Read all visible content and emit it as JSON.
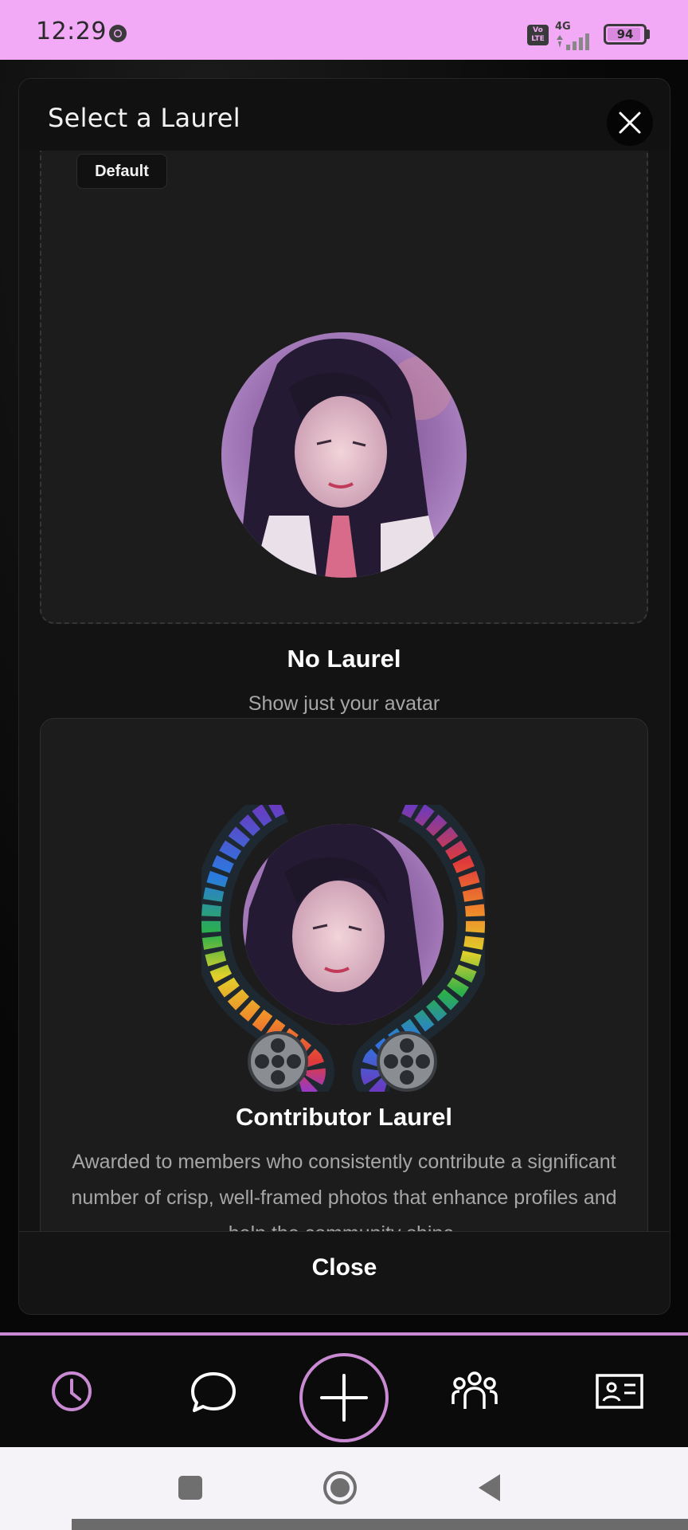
{
  "status_bar": {
    "time": "12:29",
    "volte": "Vo LTE",
    "network": "4G",
    "battery": "94",
    "battery_fraction": 0.94,
    "bg_color": "#f2aaf7"
  },
  "modal": {
    "title": "Select a Laurel",
    "close_icon": "close-icon",
    "footer_button": "Close"
  },
  "laurels": [
    {
      "badge": "Default",
      "name": "No Laurel",
      "description": "Show just your avatar"
    },
    {
      "name": "Contributor Laurel",
      "description": "Awarded to members who consistently contribute a significant number of crisp, well-framed photos that enhance profiles and help the community shine."
    }
  ],
  "bottom_nav": {
    "accent_color": "#c98ad3",
    "items": [
      "clock-icon",
      "chat-bubble-icon",
      "add-icon",
      "people-group-icon",
      "id-card-icon"
    ]
  },
  "android_nav": {
    "items": [
      "recents-icon",
      "home-icon",
      "back-icon"
    ]
  }
}
